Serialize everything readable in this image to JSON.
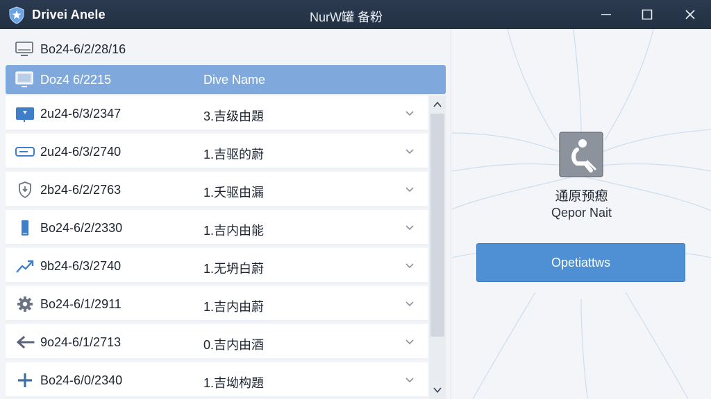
{
  "window": {
    "app_title": "Drivei Anele",
    "center_title": "NurW罐 备粉",
    "icons": {
      "app": "shield-star-icon",
      "minimize": "minimize-icon",
      "maximize": "maximize-icon",
      "close": "close-icon"
    }
  },
  "list": {
    "header_date": "Bo24-6/2/28/16",
    "selected": {
      "date": "Doz4 6/2215",
      "column_label": "Dive Name"
    },
    "rows": [
      {
        "date": "2u24-6/3/2347",
        "name": "3.吉级由題",
        "icon": "folder-icon"
      },
      {
        "date": "2u24-6/3/2740",
        "name": "1.吉驱的蔚",
        "icon": "drive-icon"
      },
      {
        "date": "2b24-6/2/2763",
        "name": "1.夭驱由漏",
        "icon": "download-shield-icon"
      },
      {
        "date": "Bo24-6/2/2330",
        "name": "1.吉内由能",
        "icon": "usb-stick-icon"
      },
      {
        "date": "9b24-6/3/2740",
        "name": "1.无坍白蔚",
        "icon": "trend-icon"
      },
      {
        "date": "Bo24-6/1/2911",
        "name": "1.吉内由蔚",
        "icon": "gear-icon"
      },
      {
        "date": "9o24-6/1/2713",
        "name": "0.吉内由酒",
        "icon": "arrow-left-icon"
      },
      {
        "date": "Bo24-6/0/2340",
        "name": "1.吉坳构題",
        "icon": "plus-icon"
      }
    ]
  },
  "detail": {
    "title": "通原预瘛",
    "subtitle": "Qepor Nait",
    "button_label": "Opetiattws",
    "icon": "device-person-icon"
  },
  "colors": {
    "accent": "#4f8fd3",
    "selected_row": "#7fa9dc",
    "titlebar": "#26354a"
  }
}
